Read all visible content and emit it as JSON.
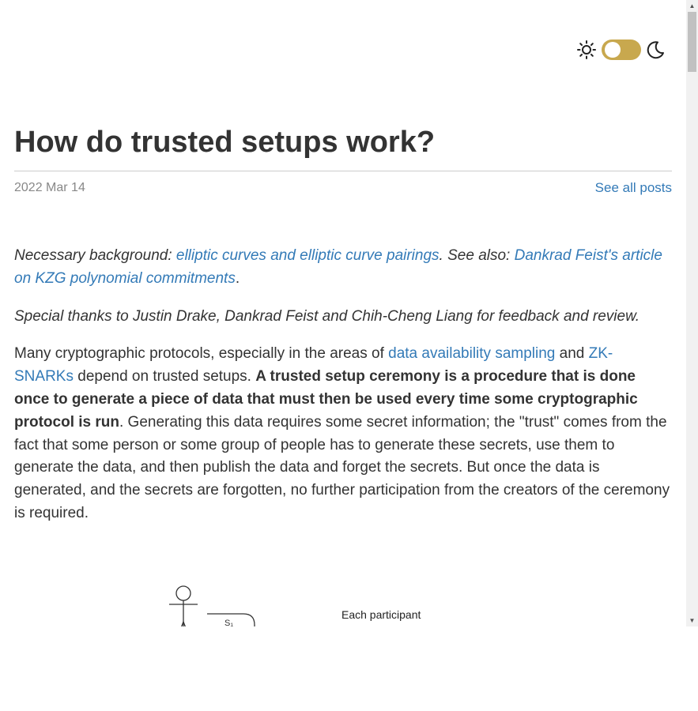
{
  "theme_toggle": {
    "sun_icon": "sun-icon",
    "moon_icon": "moon-icon",
    "accent": "#c8a84e"
  },
  "post": {
    "title": "How do trusted setups work?",
    "date": "2022 Mar 14",
    "see_all_label": "See all posts"
  },
  "background": {
    "prefix": "Necessary background: ",
    "link1": "elliptic curves and elliptic curve pairings",
    "middle": ". See also: ",
    "link2": "Dankrad Feist's article on KZG polynomial commitments",
    "suffix": "."
  },
  "thanks": "Special thanks to Justin Drake, Dankrad Feist and Chih-Cheng Liang for feedback and review.",
  "intro": {
    "part1": "Many cryptographic protocols, especially in the areas of ",
    "link1": "data availability sampling",
    "part2": " and ",
    "link2": "ZK-SNARKs",
    "part3": " depend on trusted setups. ",
    "bold": "A trusted setup ceremony is a procedure that is done once to generate a piece of data that must then be used every time some cryptographic protocol is run",
    "part4": ". Generating this data requires some secret information; the \"trust\" comes from the fact that some person or some group of people has to generate these secrets, use them to generate the data, and then publish the data and forget the secrets. But once the data is generated, and the secrets are forgotten, no further participation from the creators of the ceremony is required."
  },
  "figure": {
    "secret_label": "S₁",
    "caption": "Each participant"
  },
  "colors": {
    "link": "#337ab7",
    "text": "#333333",
    "muted": "#888888"
  }
}
